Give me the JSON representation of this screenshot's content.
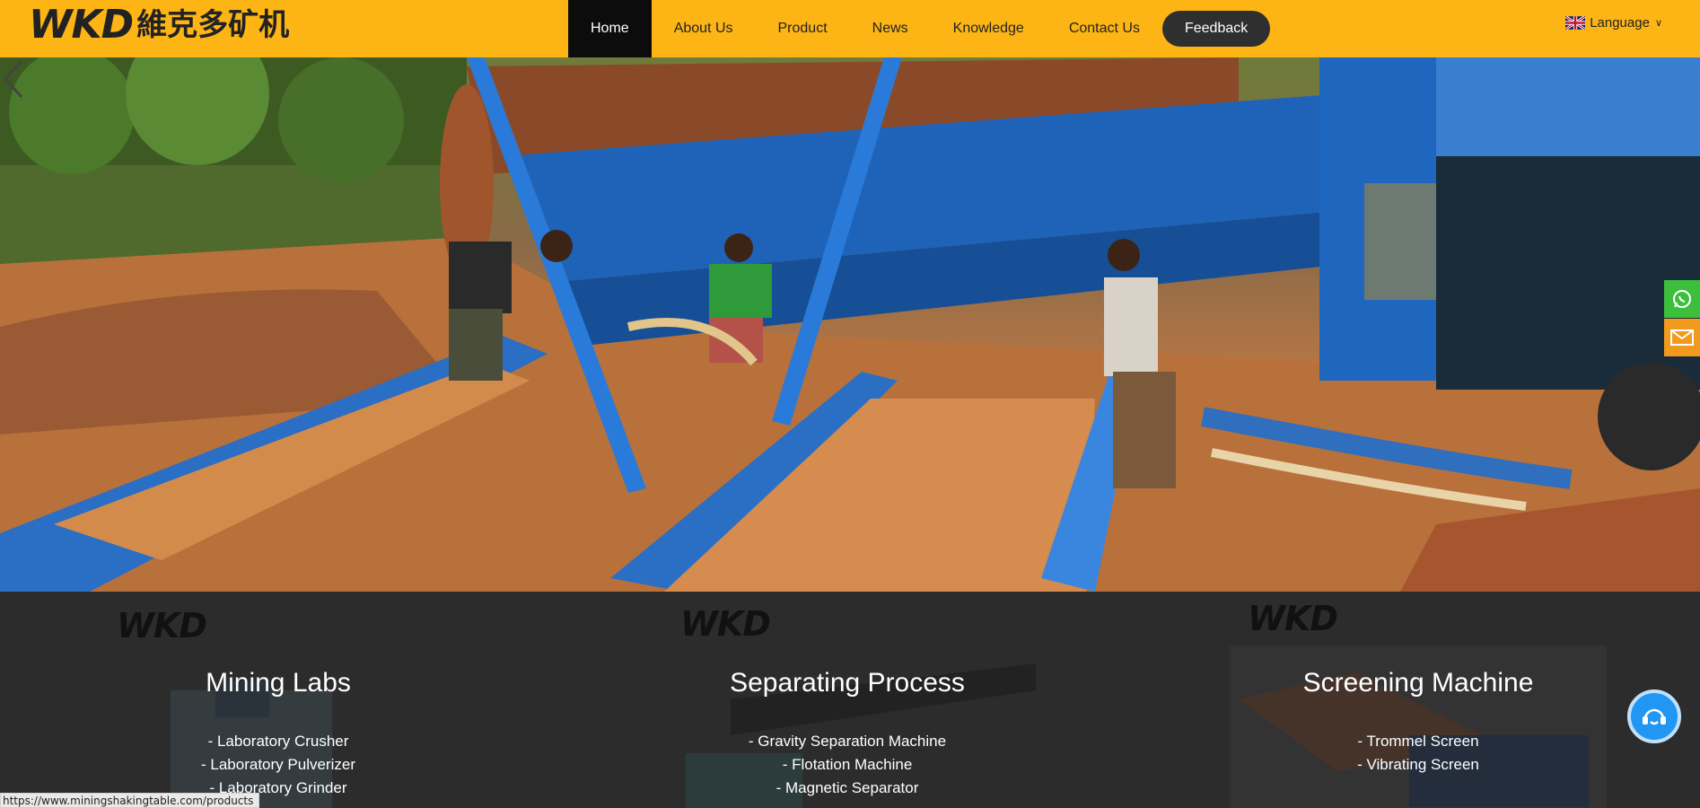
{
  "header": {
    "logo_text": "WKD",
    "logo_cn": "維克多矿机",
    "nav": [
      {
        "label": "Home",
        "active": true
      },
      {
        "label": "About Us"
      },
      {
        "label": "Product"
      },
      {
        "label": "News"
      },
      {
        "label": "Knowledge"
      },
      {
        "label": "Contact Us"
      }
    ],
    "feedback_label": "Feedback",
    "language_label": "Language"
  },
  "categories": [
    {
      "logo": "WKD",
      "title": "Mining Labs",
      "items": [
        "- Laboratory Crusher",
        "- Laboratory Pulverizer",
        "- Laboratory Grinder"
      ]
    },
    {
      "logo": "WKD",
      "title": "Separating Process",
      "items": [
        "- Gravity Separation Machine",
        "- Flotation Machine",
        "- Magnetic Separator"
      ]
    },
    {
      "logo": "WKD",
      "title": "Screening Machine",
      "items": [
        "- Trommel Screen",
        "- Vibrating Screen"
      ]
    }
  ],
  "status_bar_url": "https://www.miningshakingtable.com/products",
  "colors": {
    "brand_yellow": "#fdb515",
    "nav_active": "#0c0c0c",
    "whatsapp": "#3cbf3c",
    "mail": "#f29a1e",
    "chat": "#2196f3"
  },
  "icons": [
    "uk-flag-icon",
    "chevron-down-icon",
    "arrow-left-icon",
    "whatsapp-icon",
    "mail-icon",
    "chat-icon"
  ]
}
